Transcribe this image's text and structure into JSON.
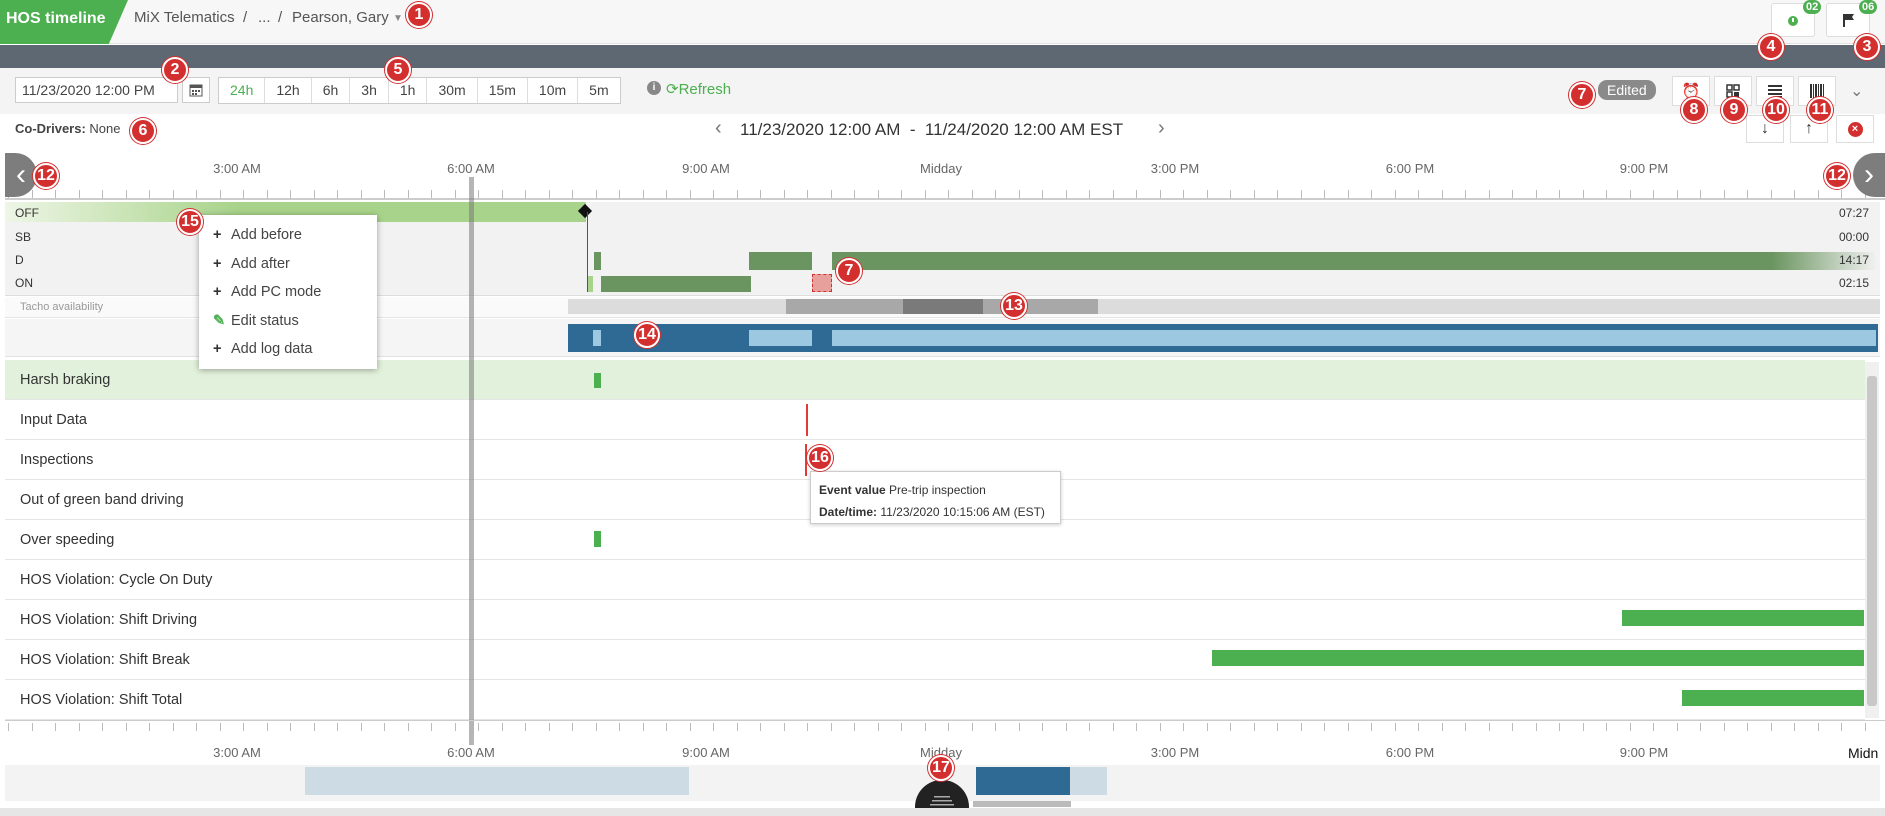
{
  "header": {
    "app_tab": "HOS timeline",
    "breadcrumb": [
      "MiX Telematics",
      "/",
      "...",
      "/",
      "Pearson, Gary"
    ],
    "notification_counts": [
      "02",
      "06"
    ]
  },
  "toolbar": {
    "date_value": "11/23/2020 12:00 PM",
    "zoom_options": [
      "24h",
      "12h",
      "6h",
      "3h",
      "1h",
      "30m",
      "15m",
      "10m",
      "5m"
    ],
    "zoom_selected": "24h",
    "refresh_label": "Refresh",
    "edited_label": "Edited"
  },
  "codrivers": {
    "label": "Co-Drivers:",
    "value": "None"
  },
  "date_range": "11/23/2020 12:00 AM  -  11/24/2020 12:00 AM EST",
  "axis": {
    "top_labels": [
      "3:00 AM",
      "6:00 AM",
      "9:00 AM",
      "Midday",
      "3:00 PM",
      "6:00 PM",
      "9:00 PM"
    ],
    "bottom_labels": [
      "3:00 AM",
      "6:00 AM",
      "9:00 AM",
      "Midday",
      "3:00 PM",
      "6:00 PM",
      "9:00 PM",
      "Midn"
    ]
  },
  "statuses": [
    {
      "code": "OFF",
      "total": "07:27"
    },
    {
      "code": "SB",
      "total": "00:00"
    },
    {
      "code": "D",
      "total": "14:17"
    },
    {
      "code": "ON",
      "total": "02:15"
    }
  ],
  "tacho_label": "Tacho availability",
  "event_rows": [
    "Harsh braking",
    "Input Data",
    "Inspections",
    "Out of green band driving",
    "Over speeding",
    "HOS Violation: Cycle On Duty",
    "HOS Violation: Shift Driving",
    "HOS Violation: Shift Break",
    "HOS Violation: Shift Total"
  ],
  "context_menu": [
    "Add before",
    "Add after",
    "Add PC mode",
    "Edit status",
    "Add log data"
  ],
  "tooltip": {
    "event_label": "Event value",
    "event_value": "Pre-trip inspection",
    "date_label": "Date/time:",
    "date_value": "11/23/2020 10:15:06 AM (EST)"
  },
  "markers": [
    "1",
    "2",
    "3",
    "4",
    "5",
    "6",
    "7",
    "7",
    "8",
    "9",
    "10",
    "11",
    "12",
    "12",
    "13",
    "14",
    "15",
    "16",
    "17"
  ],
  "colors": {
    "accent": "#4caf50",
    "driving": "#6b9560",
    "tacho_bar": "#2e6a94",
    "marker": "#d32f2f"
  }
}
